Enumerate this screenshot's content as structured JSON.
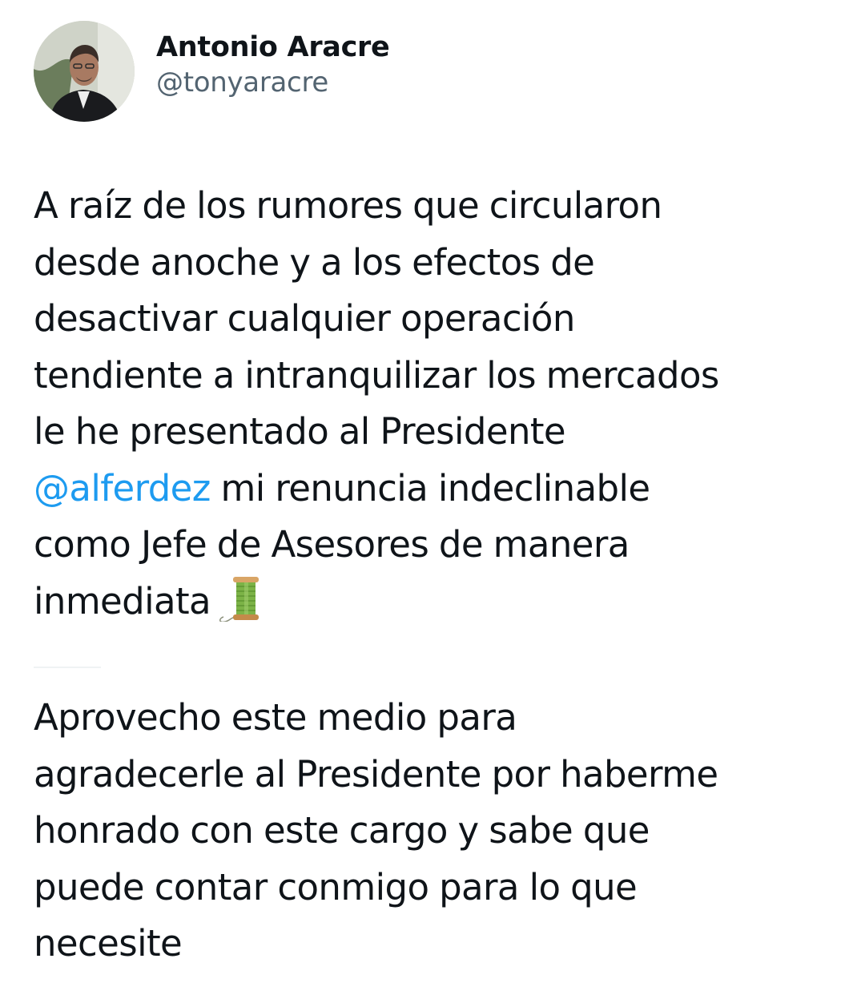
{
  "author": {
    "display_name": "Antonio Aracre",
    "handle": "@tonyaracre"
  },
  "tweet": {
    "paragraph1": {
      "line1": "A raíz de los rumores que circularon",
      "line2": "desde anoche y a los efectos de",
      "line3": "desactivar cualquier operación",
      "line4": "tendiente a intranquilizar los mercados",
      "line5": "le he presentado al Presidente",
      "mention": "@alferdez",
      "line6_rest": " mi renuncia indeclinable",
      "line7": "como Jefe de Asesores de manera",
      "line8": "inmediata",
      "emoji": "spool-of-thread-emoji"
    },
    "paragraph2": {
      "line1": "Aprovecho este medio para",
      "line2": "agradecerle al Presidente por haberme",
      "line3": "honrado con este cargo y sabe que",
      "line4": "puede contar conmigo para lo que",
      "line5": "necesite"
    }
  },
  "colors": {
    "text": "#0f1419",
    "secondary": "#536471",
    "link": "#1d9bf0",
    "divider": "#eff3f4"
  }
}
